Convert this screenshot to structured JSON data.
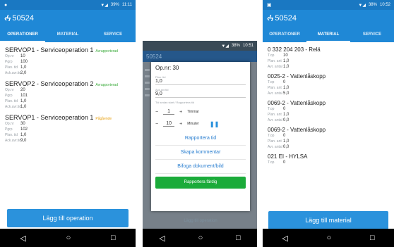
{
  "phone1": {
    "status": {
      "time": "11:11",
      "battery": "39%"
    },
    "appbar_title": "50524",
    "tabs": [
      {
        "label": "OPERATIONER",
        "active": true
      },
      {
        "label": "MATERIAL",
        "active": false
      },
      {
        "label": "SERVICE",
        "active": false
      }
    ],
    "operations": [
      {
        "title": "SERVOP1 - Serviceoperation 1",
        "status": "Avrapporterad",
        "status_color": "#3cab3c",
        "rows": [
          [
            "Op.nr",
            "10"
          ],
          [
            "Pgrp",
            "100"
          ],
          [
            "Plan. tid",
            "1,0"
          ],
          [
            "Ack.avr.tid",
            "2,0"
          ]
        ]
      },
      {
        "title": "SERVOP2 - Serviceoperation 2",
        "status": "Avrapporterad",
        "status_color": "#3cab3c",
        "rows": [
          [
            "Op.nr",
            "20"
          ],
          [
            "Pgrp",
            "101"
          ],
          [
            "Plan. tid",
            "1,0"
          ],
          [
            "Ack.avr.tid",
            "1,0"
          ]
        ]
      },
      {
        "title": "SERVOP1 - Serviceoperation 1",
        "status": "Pågående",
        "status_color": "#e8a317",
        "rows": [
          [
            "Op.nr",
            "30"
          ],
          [
            "Pgrp",
            "102"
          ],
          [
            "Plan. tid",
            "1,0"
          ],
          [
            "Ack.avr.tid",
            "9,0"
          ]
        ]
      }
    ],
    "add_button": "Lägg till operation"
  },
  "phone2": {
    "status": {
      "time": "10:51",
      "battery": "38%"
    },
    "appbar_title": "50524",
    "dialog": {
      "title": "Op.nr: 30",
      "plan_label": "Plan. tid",
      "plan_value": "1,0",
      "ack_label": "Ack.avr.tid",
      "ack_value": "9,0",
      "since_label": "Tid sedan start / Rapportera tid",
      "hours_value": "1",
      "hours_unit": "Timmar",
      "minutes_value": "10",
      "minutes_unit": "Minuter",
      "report_time": "Rapportera tid",
      "comment": "Skapa kommentar",
      "attach": "Bifoga dokument/bild",
      "report_done": "Rapportera färdig"
    },
    "under_button": "Lägg till operation"
  },
  "phone3": {
    "status": {
      "time": "10:52",
      "battery": "38%"
    },
    "appbar_title": "50524",
    "tabs": [
      {
        "label": "OPERATIONER",
        "active": false
      },
      {
        "label": "MATERIAL",
        "active": true
      },
      {
        "label": "SERVICE",
        "active": false
      }
    ],
    "materials": [
      {
        "title": "0 332 204 203 - Relä",
        "rows": [
          [
            "T.op",
            "10"
          ],
          [
            "Plan. ant",
            "1,0"
          ],
          [
            "Avr. antal",
            "1,0"
          ]
        ]
      },
      {
        "title": "0025-2 - Vattenlåskopp",
        "rows": [
          [
            "T.op",
            "0"
          ],
          [
            "Plan. ant",
            "1,0"
          ],
          [
            "Avr. antal",
            "5,0"
          ]
        ]
      },
      {
        "title": "0069-2 - Vattenlåskopp",
        "rows": [
          [
            "T.op",
            "0"
          ],
          [
            "Plan. ant",
            "1,0"
          ],
          [
            "Avr. antal",
            "0,0"
          ]
        ]
      },
      {
        "title": "0069-2 - Vattenlåskopp",
        "rows": [
          [
            "T.op",
            "0"
          ],
          [
            "Plan. ant",
            "1,0"
          ],
          [
            "Avr. antal",
            "0,0"
          ]
        ]
      },
      {
        "title": "021 EI - HYLSA",
        "rows": [
          [
            "T.op",
            "0"
          ]
        ]
      }
    ],
    "add_button": "Lägg till material"
  }
}
